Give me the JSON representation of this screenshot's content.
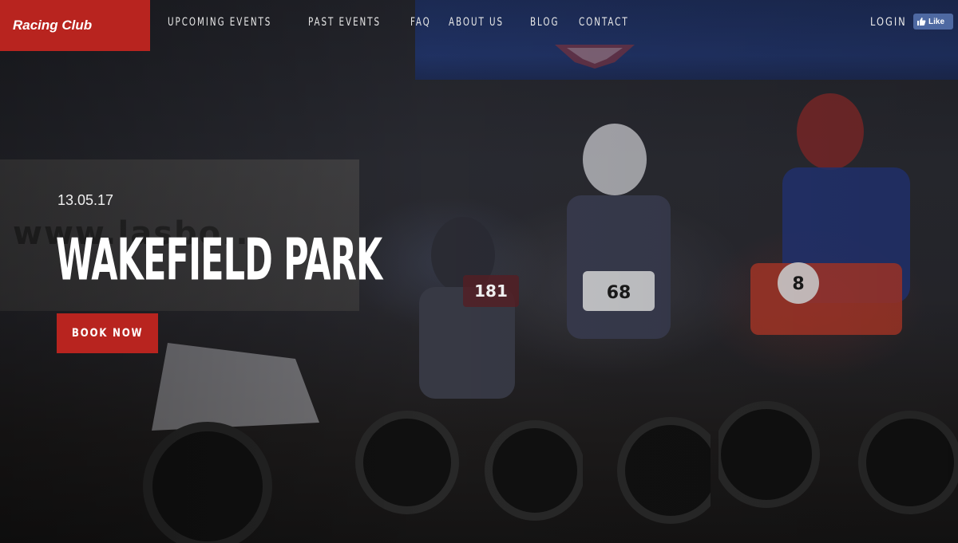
{
  "brand": {
    "name": "Racing Club"
  },
  "nav": {
    "items": [
      {
        "label": "UPCOMING EVENTS"
      },
      {
        "label": "PAST EVENTS"
      },
      {
        "label": "FAQ"
      },
      {
        "label": "ABOUT US"
      },
      {
        "label": "BLOG"
      },
      {
        "label": "CONTACT"
      }
    ],
    "login_label": "LOGIN",
    "like_label": "Like"
  },
  "hero": {
    "date": "13.05.17",
    "title": "WAKEFIELD PARK",
    "cta_label": "BOOK NOW",
    "quad_numbers": [
      "181",
      "68",
      "8"
    ]
  },
  "colors": {
    "brand_red": "#b8241f",
    "facebook_blue": "#4e69a2",
    "text_light": "#ffffff"
  }
}
